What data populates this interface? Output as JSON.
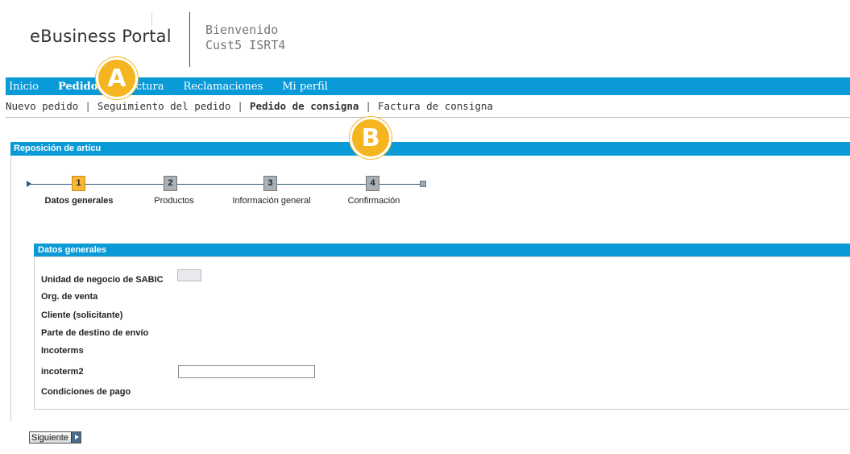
{
  "header": {
    "brand": "eBusiness Portal",
    "welcome_line1": "Bienvenido",
    "welcome_line2": "Cust5 ISRT4"
  },
  "topnav": {
    "items": [
      {
        "label": "Inicio",
        "active": false
      },
      {
        "label": "Pedidos",
        "active": true
      },
      {
        "label": "Factura",
        "active": false
      },
      {
        "label": "Reclamaciones",
        "active": false
      },
      {
        "label": "Mi perfil",
        "active": false
      }
    ]
  },
  "subnav": {
    "items": [
      {
        "label": "Nuevo pedido",
        "active": false
      },
      {
        "label": "Seguimiento del pedido",
        "active": false
      },
      {
        "label": "Pedido de consigna",
        "active": true
      },
      {
        "label": "Factura de consigna",
        "active": false
      }
    ],
    "separator": "|"
  },
  "callouts": {
    "a": "A",
    "b": "B"
  },
  "panel": {
    "title": "Reposición de artícu"
  },
  "steps": [
    {
      "number": "1",
      "label": "Datos generales",
      "state": "current"
    },
    {
      "number": "2",
      "label": "Productos",
      "state": "todo"
    },
    {
      "number": "3",
      "label": "Información general",
      "state": "todo"
    },
    {
      "number": "4",
      "label": "Confirmación",
      "state": "todo"
    }
  ],
  "section": {
    "title": "Datos generales",
    "fields": {
      "business_unit": "Unidad de negocio de SABIC",
      "sales_org": "Org. de venta",
      "customer": "Cliente (solicitante)",
      "ship_to": "Parte de destino de envío",
      "incoterms": "Incoterms",
      "incoterm2": "incoterm2",
      "payment_terms": "Condiciones de pago"
    },
    "incoterm2_value": ""
  },
  "buttons": {
    "next": "Siguiente"
  },
  "colors": {
    "nav_blue": "#0a9ad8",
    "step_current": "#f9b733",
    "step_todo": "#a9b1b8",
    "callout": "#f5b521"
  }
}
